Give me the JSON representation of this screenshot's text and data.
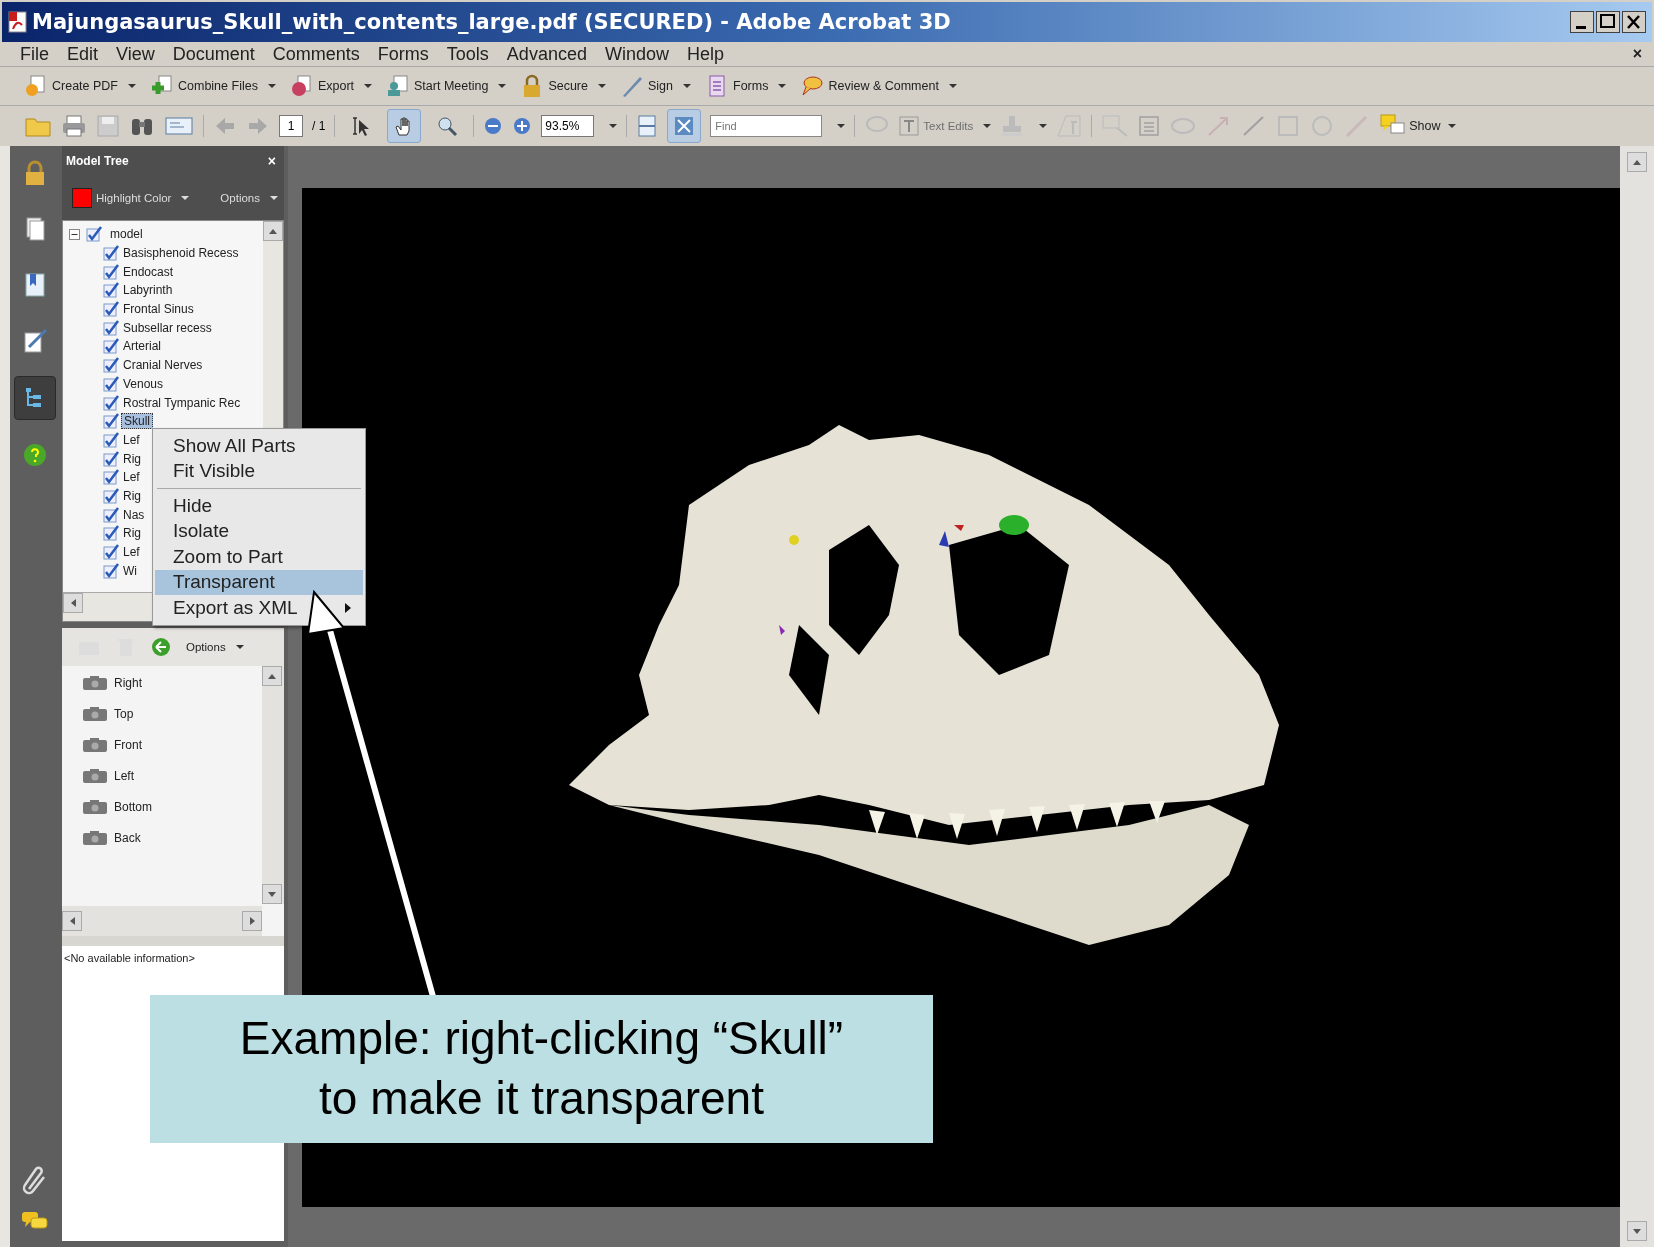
{
  "window": {
    "title": "Majungasaurus_Skull_with_contents_large.pdf (SECURED) - Adobe Acrobat 3D"
  },
  "menu_bar": {
    "items": [
      "File",
      "Edit",
      "View",
      "Document",
      "Comments",
      "Forms",
      "Tools",
      "Advanced",
      "Window",
      "Help"
    ],
    "close": "×"
  },
  "task_toolbar": [
    {
      "label": "Create PDF",
      "kind": "create"
    },
    {
      "label": "Combine Files",
      "kind": "combine"
    },
    {
      "label": "Export",
      "kind": "export"
    },
    {
      "label": "Start Meeting",
      "kind": "meeting"
    },
    {
      "label": "Secure",
      "kind": "secure"
    },
    {
      "label": "Sign",
      "kind": "sign"
    },
    {
      "label": "Forms",
      "kind": "forms"
    },
    {
      "label": "Review & Comment",
      "kind": "review"
    }
  ],
  "toolbar": {
    "page_number": "1",
    "page_count": "/ 1",
    "zoom": "93.5%",
    "find_placeholder": "Find",
    "text_edits": {
      "label": "Text Edits",
      "disabled": true
    },
    "show": "Show",
    "tools": [
      {
        "kind": "select",
        "selected": false
      },
      {
        "kind": "hand",
        "selected": true
      },
      {
        "kind": "zoom",
        "selected": false
      }
    ]
  },
  "nav_pane": [
    {
      "kind": "lock",
      "selected": false
    },
    {
      "kind": "pages",
      "selected": false
    },
    {
      "kind": "bookmarks",
      "selected": false
    },
    {
      "kind": "signatures",
      "selected": false
    },
    {
      "kind": "model-tree",
      "selected": true
    },
    {
      "kind": "help",
      "selected": false
    }
  ],
  "model_tree": {
    "title": "Model Tree",
    "close": "×",
    "highlight_label": "Highlight Color",
    "options": "Options",
    "root": {
      "label": "model",
      "checked": true,
      "expanded": true,
      "selected": false,
      "children": [
        {
          "label": "Basisphenoid Recess",
          "checked": true,
          "selected": false
        },
        {
          "label": "Endocast",
          "checked": true,
          "selected": false
        },
        {
          "label": "Labyrinth",
          "checked": true,
          "selected": false
        },
        {
          "label": "Frontal Sinus",
          "checked": true,
          "selected": false
        },
        {
          "label": "Subsellar recess",
          "checked": true,
          "selected": false
        },
        {
          "label": "Arterial",
          "checked": true,
          "selected": false
        },
        {
          "label": "Cranial Nerves",
          "checked": true,
          "selected": false
        },
        {
          "label": "Venous",
          "checked": true,
          "selected": false
        },
        {
          "label": "Rostral Tympanic Rec",
          "checked": true,
          "selected": false
        },
        {
          "label": "Skull",
          "checked": true,
          "selected": true
        },
        {
          "label": "Lef",
          "checked": true,
          "selected": false
        },
        {
          "label": "Rig",
          "checked": true,
          "selected": false
        },
        {
          "label": "Lef",
          "checked": true,
          "selected": false
        },
        {
          "label": "Rig",
          "checked": true,
          "selected": false
        },
        {
          "label": "Nas",
          "checked": true,
          "selected": false
        },
        {
          "label": "Rig",
          "checked": true,
          "selected": false
        },
        {
          "label": "Lef",
          "checked": true,
          "selected": false
        },
        {
          "label": "Wi",
          "checked": true,
          "selected": false
        }
      ]
    }
  },
  "context_menu": {
    "items": [
      {
        "kind": "item",
        "label": "Show All Parts",
        "selected": false,
        "submenu": false
      },
      {
        "kind": "item",
        "label": "Fit Visible",
        "selected": false,
        "submenu": false
      },
      {
        "kind": "separator"
      },
      {
        "kind": "item",
        "label": "Hide",
        "selected": false,
        "submenu": false
      },
      {
        "kind": "item",
        "label": "Isolate",
        "selected": false,
        "submenu": false
      },
      {
        "kind": "item",
        "label": "Zoom to Part",
        "selected": false,
        "submenu": false
      },
      {
        "kind": "item",
        "label": "Transparent",
        "selected": true,
        "submenu": false
      },
      {
        "kind": "item",
        "label": "Export as XML",
        "selected": false,
        "submenu": true
      }
    ]
  },
  "views": {
    "options": "Options",
    "items": [
      "Right",
      "Top",
      "Front",
      "Left",
      "Bottom",
      "Back"
    ]
  },
  "info": {
    "text": "<No available information>"
  },
  "callout": {
    "text": "Example: right-clicking “Skull” to make it transparent"
  }
}
